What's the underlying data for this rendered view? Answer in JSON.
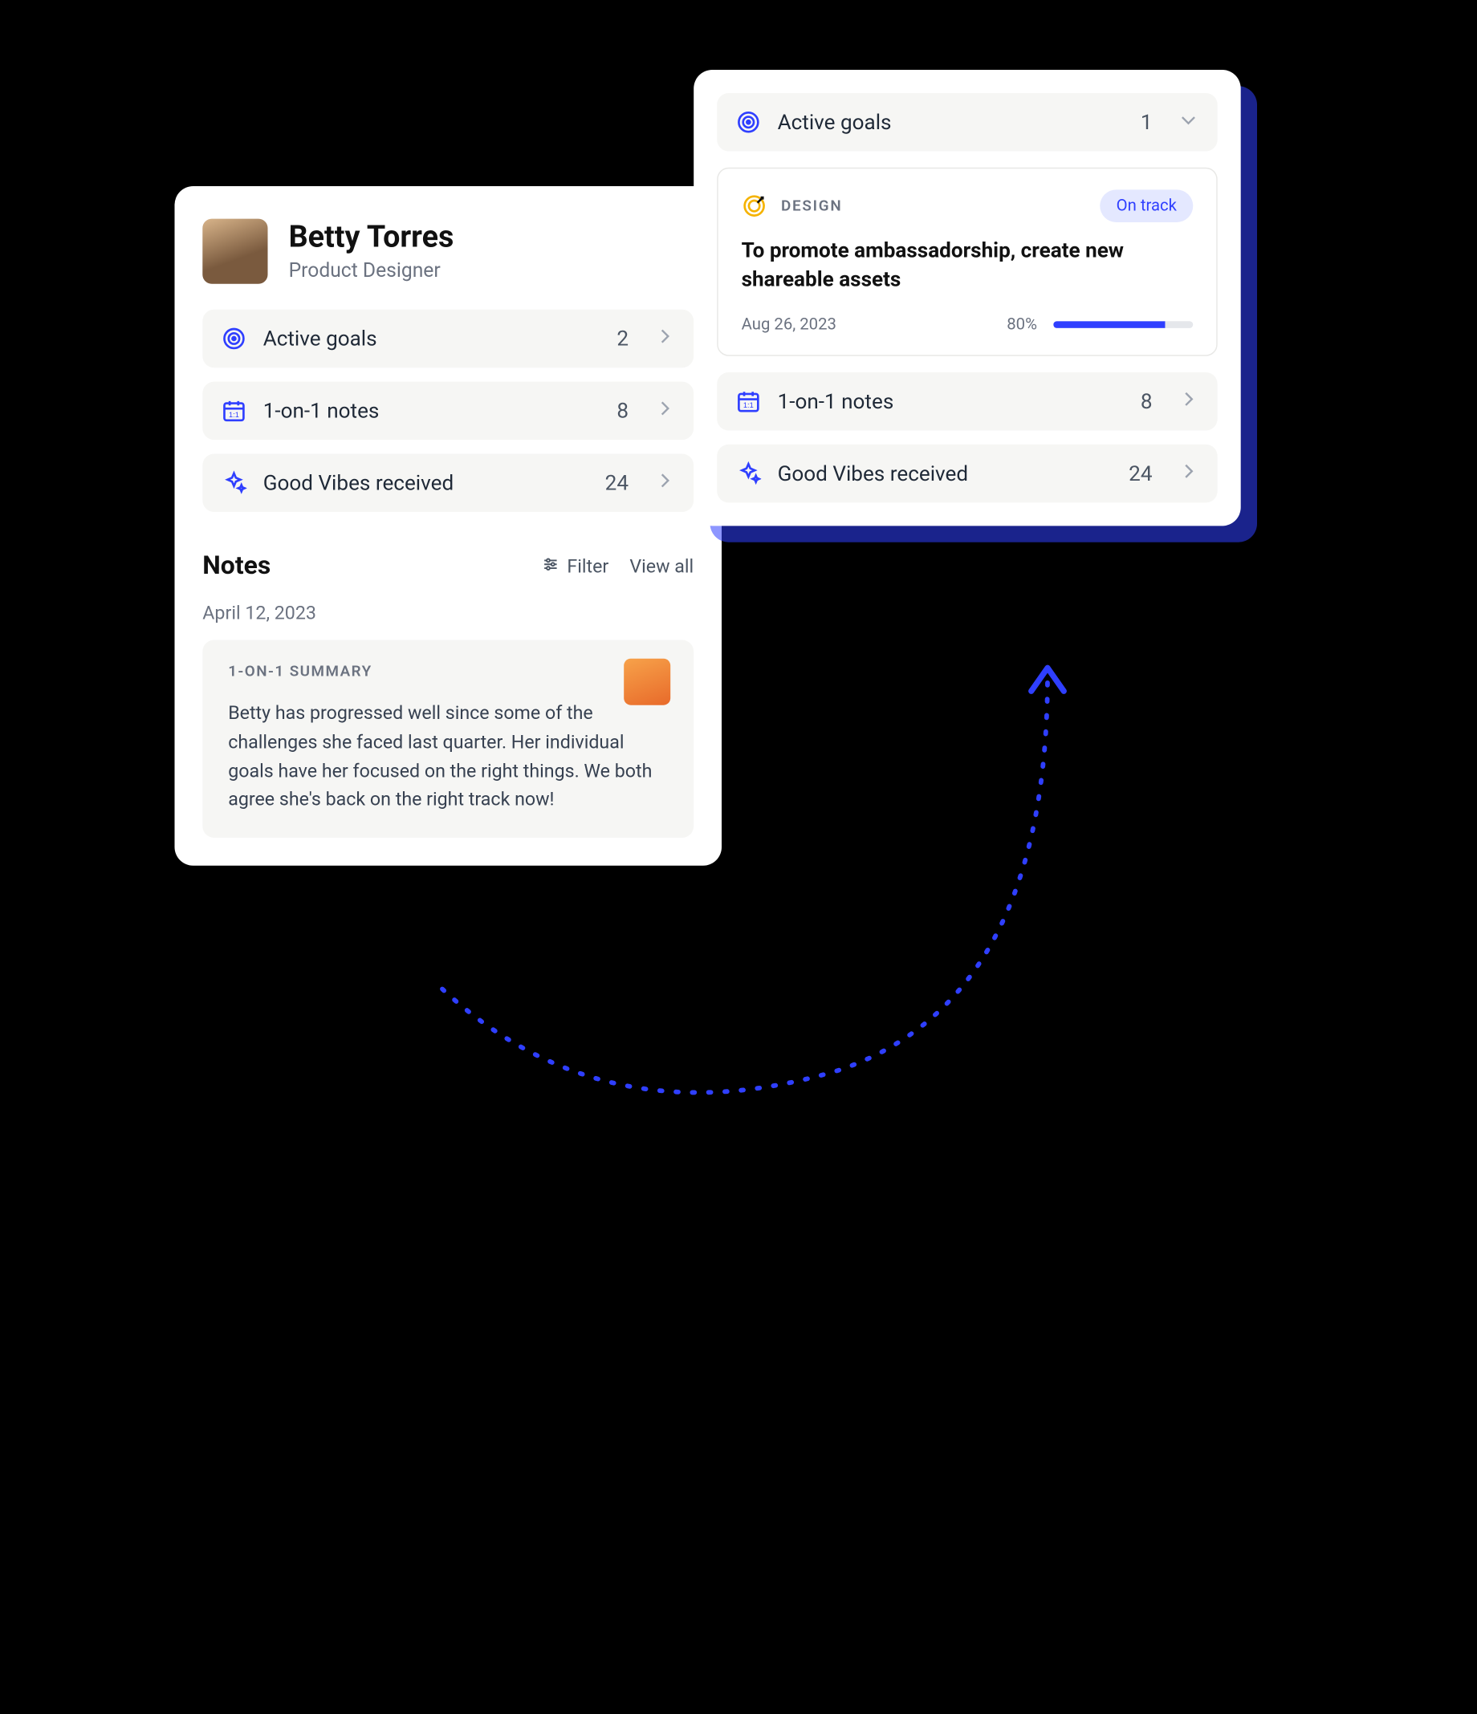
{
  "profile": {
    "name": "Betty Torres",
    "role": "Product Designer",
    "stats": {
      "active_goals": {
        "label": "Active goals",
        "count": "2"
      },
      "one_on_one": {
        "label": "1-on-1 notes",
        "count": "8"
      },
      "good_vibes": {
        "label": "Good Vibes received",
        "count": "24"
      }
    }
  },
  "notes": {
    "title": "Notes",
    "filter_label": "Filter",
    "viewall_label": "View all",
    "date": "April 12, 2023",
    "category": "1-ON-1 SUMMARY",
    "body": "Betty has progressed well since some of the challenges she faced last quarter. Her individual goals have her focused on the right things. We both agree she's back on the right track now!"
  },
  "goals_panel": {
    "header": {
      "label": "Active goals",
      "count": "1"
    },
    "goal": {
      "category": "DESIGN",
      "status_badge": "On track",
      "title": "To promote ambassadorship, create new shareable assets",
      "date": "Aug 26, 2023",
      "percent_label": "80%",
      "percent_value": 80
    },
    "one_on_one": {
      "label": "1-on-1 notes",
      "count": "8"
    },
    "good_vibes": {
      "label": "Good Vibes received",
      "count": "24"
    }
  }
}
